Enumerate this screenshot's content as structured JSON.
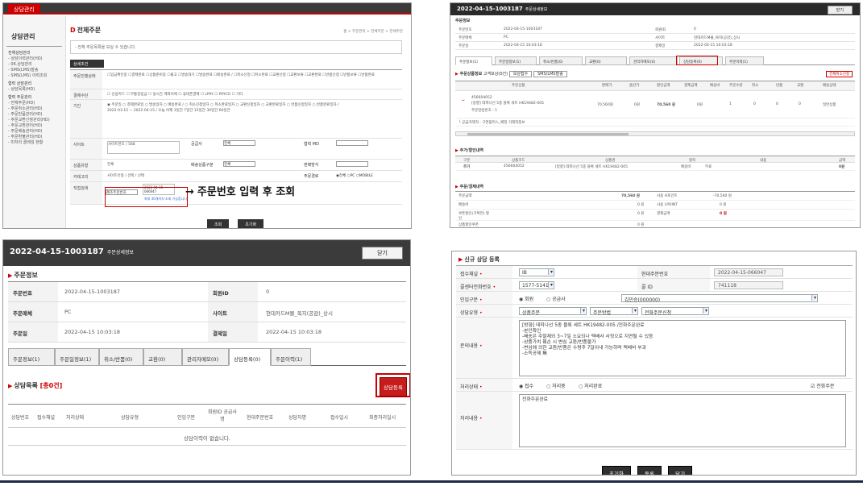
{
  "p1": {
    "tab": "상담관리",
    "side_title": "상담관리",
    "side_menu": [
      "전체상담관리",
      "- 상담이력관리(HD)",
      "- 06.상담관리",
      "- SMS(LMS)발송",
      "- SMS(LMS) 이력조회",
      "협력 상담관리",
      "- 상담목록(HD)",
      "협력 주문관리",
      "- 전체주문(HD)",
      "- 주문취소관리(HD)",
      "- 주문반품관리(HD)",
      "- 주문교환신청관리(HD)",
      "- 주문교환관리(HD)",
      "- 주문배송관리(HD)",
      "- 주문환불관리(HD)",
      "- 미처리 클레임 현황"
    ],
    "title": "전체주문",
    "breadcrumb": "홈 > 주문관리 > 전체주문 > 전체주문",
    "notice": "- 전체 주문목록을 보실 수 있습니다.",
    "option_tab": "상세조건",
    "rows": [
      {
        "label": "주문진행상태",
        "value": "☐입금확인중 ☐결제완료 ☐상품준비중 ☐출고 ☐발송대기 ☐발송완료 ☐배송완료 / ☐취소신청 ☐취소완료 ☐교환신청 ☐교환보류 ☐교환완료 ☐반품신청 ☐반품보류 ☐반품완료"
      },
      {
        "label": "결제수단",
        "value": "☐ 신용카드 ☐ 무통장입금 ☐ 실시간 계좌이체 ☐ 휴대폰결제 ☐ LPAY ☐ PAYCO ☐ 기타"
      },
      {
        "label": "기간",
        "value": "◉ 주문일 ○ 결제완료일 ○ 발송일자 ○ 배송완료 / ○ 취소신청일자 ○ 취소완료일자 ○ 교환신청일자 ○ 교환완료일자 ○ 반품신청일자 ○ 반품완료일자 / 2022-03-15 ~ 2022-04-15 / 오늘 어제 3일간 7일간 15일간 30일간 60일간"
      },
      {
        "label": "사이트",
        "value": "사이트번호 / 568"
      },
      {
        "label": "상품유형",
        "value": "전체"
      },
      {
        "label": "카테고리",
        "value": "사이트유형 / 선택 / 선택"
      },
      {
        "label": "직접검색",
        "value": "제조주문번호"
      }
    ],
    "mid_labels": [
      "공급사",
      "배송상품구분",
      "판매방식",
      "주문경로"
    ],
    "mid_values": [
      "전체",
      "전체",
      "",
      "◉전체 ○PC ○MOBILE"
    ],
    "right_label": "협력 MD",
    "search_value": "2022-04-15-066047",
    "search_hint": "최대 30개까지 조회 가능합니다.",
    "btn_search": "조회",
    "btn_reset": "초기화"
  },
  "callout": "주문번호 입력 후 조회",
  "p2": {
    "header_id": "2022-04-15-1003187",
    "header_sub": "주문상세정보",
    "close": "닫기",
    "sec_order": "주문정보",
    "info": [
      [
        "주문번호",
        "2022-04-15-1003187",
        "회원ID",
        "0"
      ],
      [
        "주문매체",
        "PC",
        "사이트",
        "현대카드M몰_복지(공감)_상시"
      ],
      [
        "주문일",
        "2022-04-15 10:03:18",
        "결제일",
        "2022-04-15 10:03:18"
      ]
    ],
    "tabs": [
      "주문정보(1)",
      "주문일정보(1)",
      "취소/반품(0)",
      "교환(0)",
      "관리자메모(0)",
      "상담등록(0)",
      "주문이력(1)"
    ],
    "sec_goods": "주문상품정보",
    "goods_sub": "고객보상(0건)",
    "goods_btns": [
      "보상접수",
      "SMS/LMS발송"
    ],
    "goods_cancel": "전체취소신청",
    "goods_cols": [
      "주문상품",
      "판매가",
      "옵션가",
      "할인금액",
      "결제금액",
      "배송비",
      "주문수량",
      "취소",
      "반품",
      "교환",
      "배송상태"
    ],
    "goods_code": "456604052",
    "goods_name": "[방향] 데피나선 5종 블록 세트 HK19482-005",
    "goods_seller": "주문일련번호 : 1",
    "goods_vals": [
      "70,560원",
      "0원",
      "70,560 원",
      "0원",
      "1",
      "0",
      "0",
      "0",
      "일반상품"
    ],
    "goods_note": "└ 공급거래처 : 구연플러스_패밀 거래처정보",
    "sec_add": "추가/할인내역",
    "add_cols": [
      "구분",
      "상품코드",
      "상품명",
      "항목",
      "내용",
      "금액"
    ],
    "add_row": [
      "추가",
      "456604052",
      "[방향] 데피나선 5종 블록 세트 HK19482-005",
      "배송비",
      "무료",
      "0원"
    ],
    "sec_pay": "주문/결제내역",
    "pay_rows": [
      [
        "주문금액",
        "70,560 원",
        "사용 H포인트",
        "-70,560 원"
      ],
      [
        "배송비",
        "0 원",
        "사용 LPOINT",
        "0 원"
      ],
      [
        "쿠폰할인(기획전) 할인",
        "0 원",
        "결제금액",
        "0 원"
      ],
      [
        "상품할인쿠폰",
        "0 원",
        "",
        ""
      ]
    ]
  },
  "p3": {
    "header_id": "2022-04-15-1003187",
    "header_sub": "주문상세정보",
    "close": "닫기",
    "sec_order": "주문정보",
    "info": [
      [
        "주문번호",
        "2022-04-15-1003187",
        "회원ID",
        "0"
      ],
      [
        "주문매체",
        "PC",
        "사이트",
        "현대카드M몰_복지(공감)_상시"
      ],
      [
        "주문일",
        "2022-04-15 10:03:18",
        "결제일",
        "2022-04-15 10:03:18"
      ]
    ],
    "tabs": [
      "주문정보(1)",
      "주문일정보(1)",
      "취소/반품(0)",
      "교환(0)",
      "관리자메모(0)",
      "상담등록(0)",
      "주문이력(1)"
    ],
    "sec_list": "상담목록",
    "list_count": "[총0건]",
    "reg_button": "상담등록",
    "cols": [
      "상담번호",
      "접수채널",
      "처리상태",
      "상담유형",
      "인입구분",
      "회원ID 공급사명",
      "현대주문번호",
      "상담자명",
      "접수일시",
      "최종처리일시"
    ],
    "empty": "상담이력이 없습니다."
  },
  "p4": {
    "sec": "신규 상담 등록",
    "labels": [
      "접수채널",
      "콜센터전화번호",
      "인입구분",
      "상담유형",
      "문의내용",
      "처리상태",
      "처리내용"
    ],
    "channel": "IB",
    "phone": "1577-5141",
    "order_label": "현대주문번호",
    "order_value": "2022-04-15-066047",
    "callid_label": "콜 ID",
    "callid_value": "741118",
    "radio_member": "◉ 회원",
    "radio_supplier": "○ 공급사",
    "member_name": "김민승(000000)",
    "type1": "상품주문",
    "type2": "주문방법",
    "type3": "전화주문신청",
    "inquiry": "[방향] 데피나선 5종 블록 세트 HK19482-005 /전화주문완료\n-본인확인\n-배송은 주말제외 3~7일 소요되나 택배사 사정으로 지연될 수 있음\n-상품가치 훼손 시 변심 교환/반품불가\n-변심에 의한 교환/반품은 수령후 7일이내 가능하며 택배비 부과\n-소득공제 無",
    "status_opts": [
      "◉ 접수",
      "○ 처리중",
      "○ 처리완료"
    ],
    "phone_order": "☑ 전화주문",
    "process_text": "전화주문완료",
    "btns": [
      "초기화",
      "등록",
      "닫기"
    ]
  }
}
